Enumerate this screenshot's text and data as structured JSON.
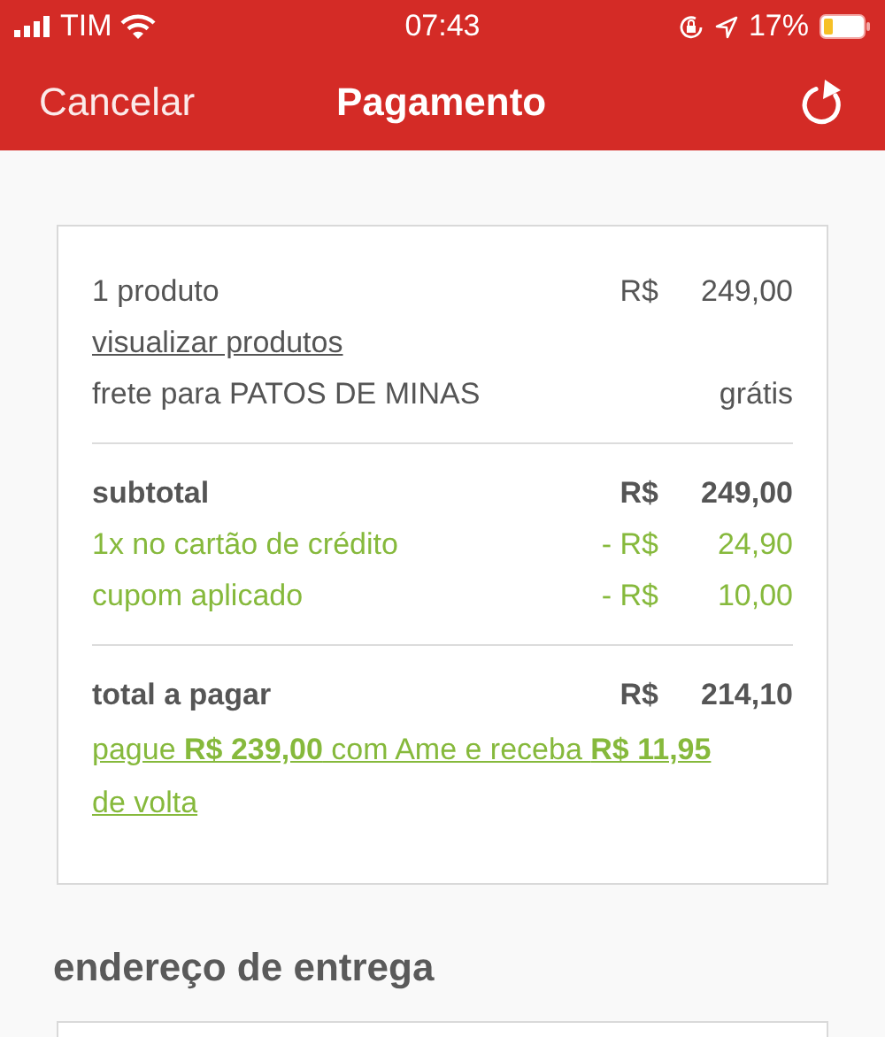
{
  "status_bar": {
    "carrier": "TIM",
    "time": "07:43",
    "battery": "17%"
  },
  "nav": {
    "cancel": "Cancelar",
    "title": "Pagamento"
  },
  "summary": {
    "sections": [
      {
        "rows": [
          {
            "kind": "plain",
            "label": "1 produto",
            "currency": "R$",
            "amount": "249,00"
          },
          {
            "kind": "link",
            "label": "visualizar produtos"
          },
          {
            "kind": "plain",
            "label": "frete para PATOS DE MINAS",
            "amount": "grátis"
          }
        ]
      },
      {
        "rows": [
          {
            "kind": "bold",
            "label": "subtotal",
            "currency": "R$",
            "amount": "249,00"
          },
          {
            "kind": "discount",
            "label": "1x no cartão de crédito",
            "currency": "- R$",
            "amount": "24,90"
          },
          {
            "kind": "discount",
            "label": "cupom aplicado",
            "currency": "- R$",
            "amount": "10,00"
          }
        ]
      },
      {
        "rows": [
          {
            "kind": "bold",
            "label": "total a pagar",
            "currency": "R$",
            "amount": "214,10"
          },
          {
            "kind": "promo",
            "label": "pague **R$ 239,00** com Ame e receba **R$ 11,95** de volta"
          }
        ]
      }
    ]
  },
  "address": {
    "title": "endereço de entrega"
  }
}
